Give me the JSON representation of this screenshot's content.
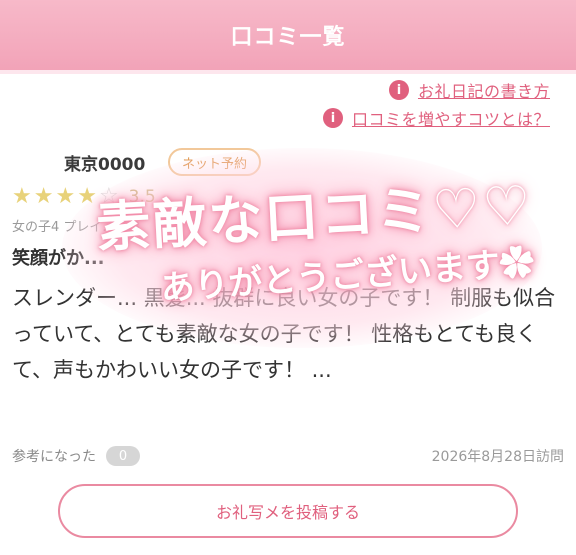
{
  "header": {
    "title": "口コミ一覧"
  },
  "links": [
    {
      "icon": "info-icon",
      "text": "お礼日記の書き方"
    },
    {
      "icon": "info-icon",
      "text": "口コミを増やすコツとは？"
    }
  ],
  "review": {
    "reviewer": "東京0000",
    "badge": "ネット予約",
    "rating": 3.5,
    "rating_text": "3.5",
    "meta": "女の子4 プレイ... 真3",
    "title": "笑顔がか...",
    "body": "スレンダー... 黒髪... 抜群に良い女の子です！ 制服も似合っていて、とても素敵な女の子です！ 性格もとても良くて、声もかわいい女の子です！ ...",
    "helpful_label": "参考になった",
    "helpful_count": "0",
    "visit_date": "2026年8月28日訪問"
  },
  "overlay": {
    "line1": "素敵な口コミ♡♡",
    "line2": "ありがとうございます✿"
  },
  "cta": {
    "label": "お礼写メを投稿する"
  },
  "colors": {
    "accent": "#e0607e",
    "header": "#f2a3b8",
    "star": "#e8d27a"
  }
}
